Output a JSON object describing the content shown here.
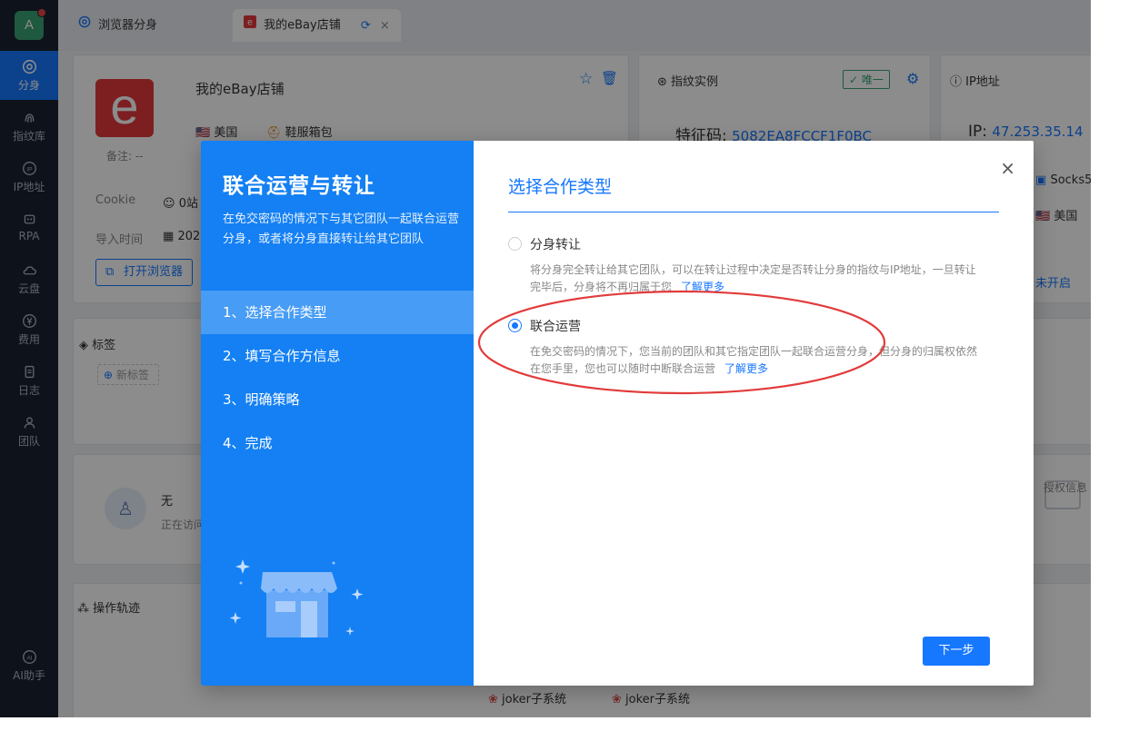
{
  "sidebar": {
    "avatar_letter": "A",
    "items": [
      {
        "label": "分身",
        "icon": "chrome-icon"
      },
      {
        "label": "指纹库",
        "icon": "fingerprint-icon"
      },
      {
        "label": "IP地址",
        "icon": "ip-icon"
      },
      {
        "label": "RPA",
        "icon": "robot-icon"
      },
      {
        "label": "云盘",
        "icon": "cloud-icon"
      },
      {
        "label": "费用",
        "icon": "yen-icon"
      },
      {
        "label": "日志",
        "icon": "log-icon"
      },
      {
        "label": "团队",
        "icon": "team-icon"
      }
    ],
    "ai_label": "AI助手"
  },
  "tabs": [
    {
      "label": "浏览器分身"
    },
    {
      "label": "我的eBay店铺"
    }
  ],
  "profile": {
    "shop_name": "我的eBay店铺",
    "country": "美国",
    "category": "鞋服箱包",
    "note": "备注: --",
    "cookie_label": "Cookie",
    "cookie_value": "0站",
    "import_label": "导入时间",
    "import_value": "202",
    "open_browser": "打开浏览器",
    "logo_letter": "e"
  },
  "fingerprint": {
    "title": "指纹实例",
    "badge": "唯一",
    "feature_label": "特征码:",
    "feature_value": "5082EA8FCCF1F0BC"
  },
  "ip": {
    "title": "IP地址",
    "ip_label": "IP:",
    "ip_value": "47.253.35.14",
    "proxy": "Socks5",
    "country": "美国",
    "status": "未开启"
  },
  "tags": {
    "title": "标签",
    "new_tag": "新标签"
  },
  "access": {
    "name": "无",
    "status": "正在访问"
  },
  "auth": {
    "label": "授权信息"
  },
  "ops": {
    "title": "操作轨迹"
  },
  "bottom_users": [
    "joker子系统",
    "joker子系统"
  ],
  "modal": {
    "title": "联合运营与转让",
    "description": "在免交密码的情况下与其它团队一起联合运营分身，或者将分身直接转让给其它团队",
    "steps": [
      "1、选择合作类型",
      "2、填写合作方信息",
      "3、明确策略",
      "4、完成"
    ],
    "section_title": "选择合作类型",
    "options": [
      {
        "label": "分身转让",
        "desc": "将分身完全转让给其它团队，可以在转让过程中决定是否转让分身的指纹与IP地址，一旦转让完毕后，分身将不再归属于您",
        "link": "了解更多",
        "checked": false
      },
      {
        "label": "联合运营",
        "desc": "在免交密码的情况下，您当前的团队和其它指定团队一起联合运营分身，但分身的归属权依然在您手里，您也可以随时中断联合运营",
        "link": "了解更多",
        "checked": true
      }
    ],
    "next": "下一步",
    "close": "×"
  },
  "colors": {
    "primary": "#1677ff",
    "modal_left": "#1480f3",
    "sidebar": "#1b2230",
    "highlight": "#e23b3b",
    "ebay_red": "#e4393c"
  }
}
